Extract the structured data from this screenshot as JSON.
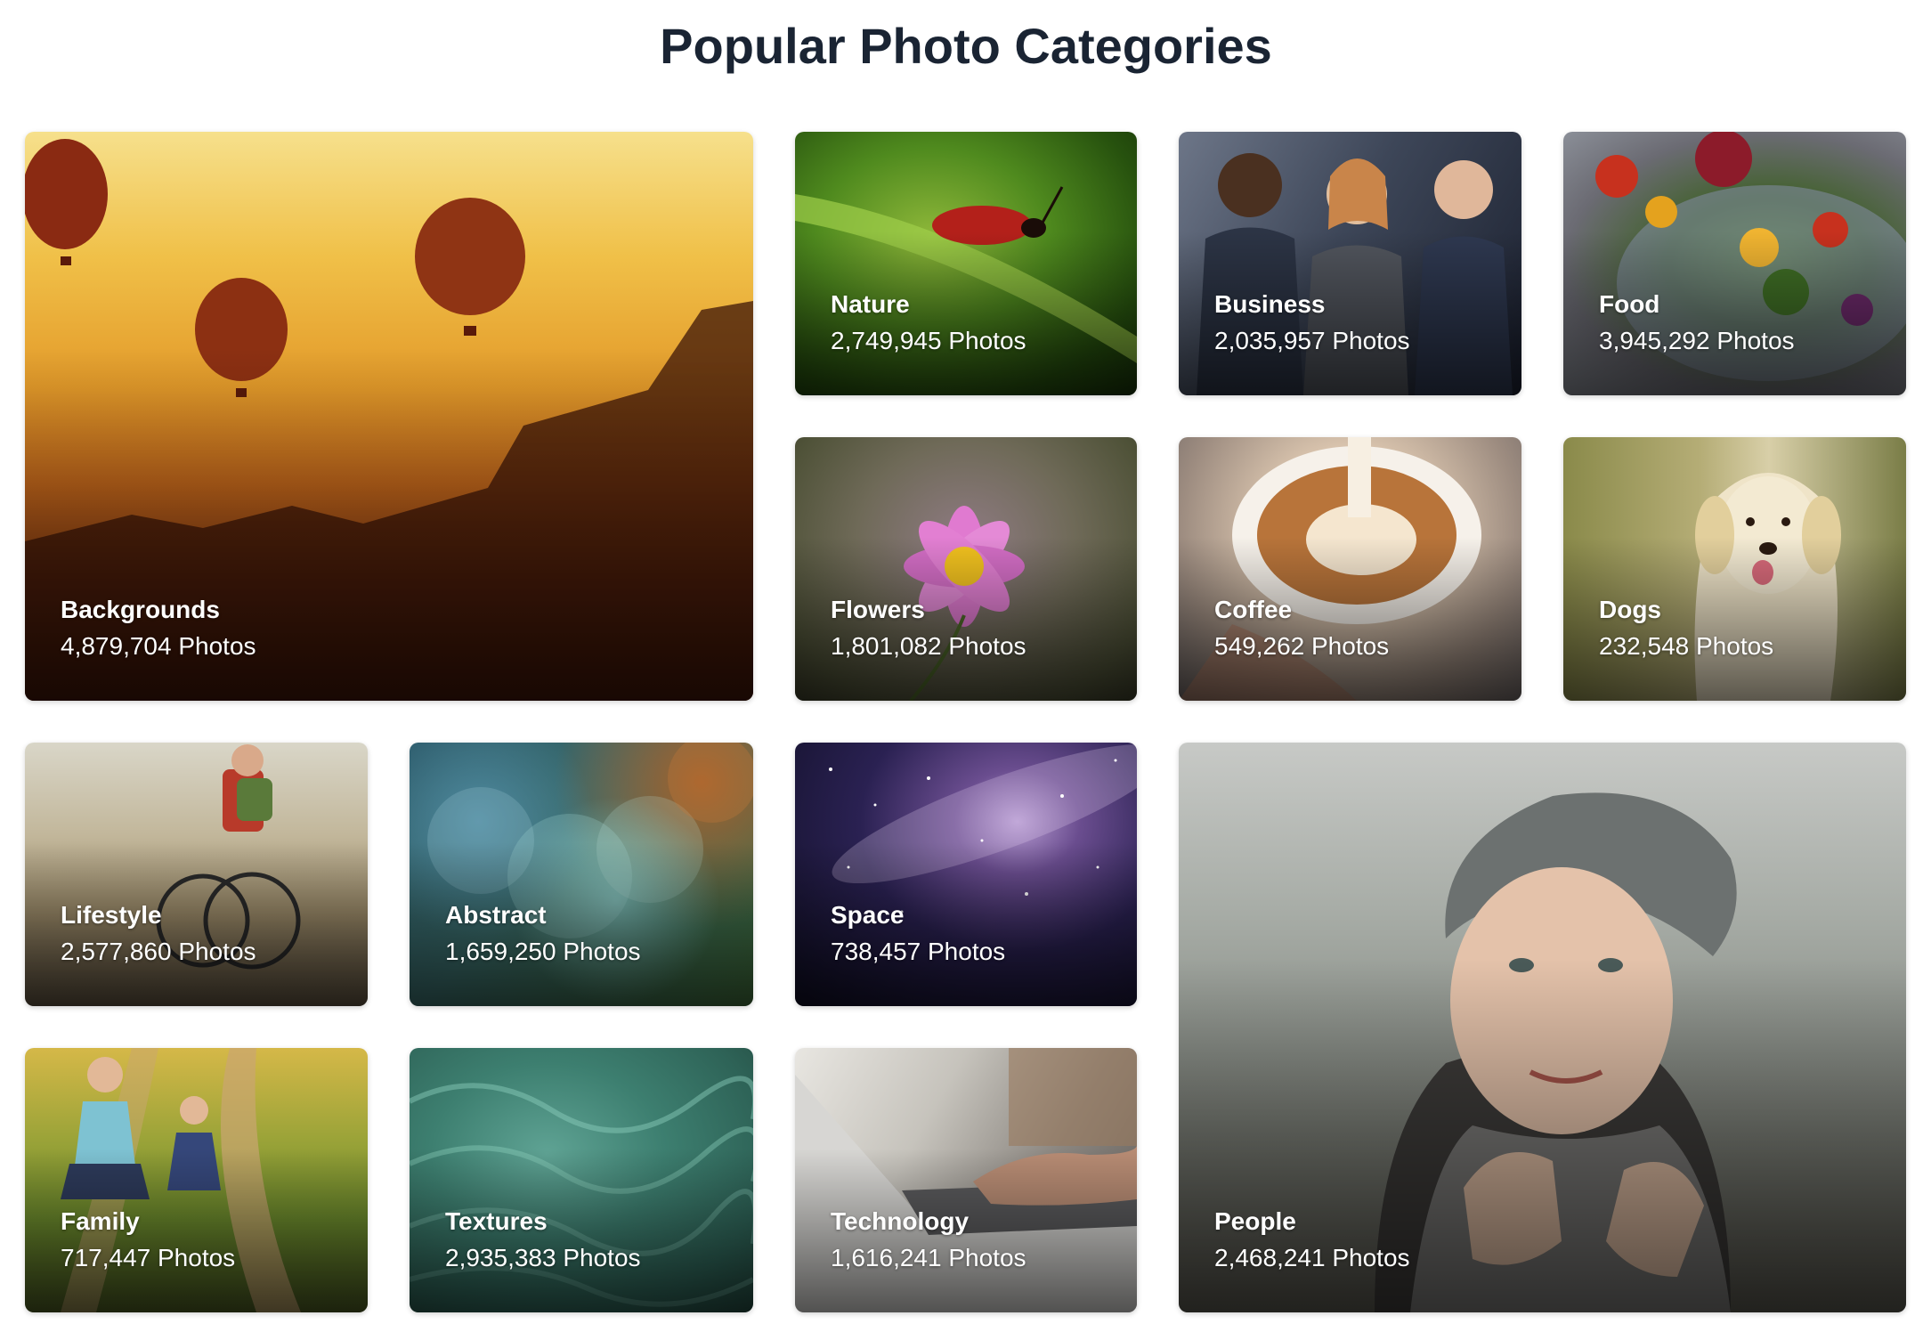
{
  "title": "Popular Photo Categories",
  "categories": [
    {
      "id": "backgrounds",
      "name": "Backgrounds",
      "count": "4,879,704 Photos"
    },
    {
      "id": "nature",
      "name": "Nature",
      "count": "2,749,945 Photos"
    },
    {
      "id": "business",
      "name": "Business",
      "count": "2,035,957 Photos"
    },
    {
      "id": "food",
      "name": "Food",
      "count": "3,945,292 Photos"
    },
    {
      "id": "flowers",
      "name": "Flowers",
      "count": "1,801,082 Photos"
    },
    {
      "id": "coffee",
      "name": "Coffee",
      "count": "549,262 Photos"
    },
    {
      "id": "dogs",
      "name": "Dogs",
      "count": "232,548 Photos"
    },
    {
      "id": "lifestyle",
      "name": "Lifestyle",
      "count": "2,577,860 Photos"
    },
    {
      "id": "abstract",
      "name": "Abstract",
      "count": "1,659,250 Photos"
    },
    {
      "id": "space",
      "name": "Space",
      "count": "738,457 Photos"
    },
    {
      "id": "people",
      "name": "People",
      "count": "2,468,241 Photos"
    },
    {
      "id": "family",
      "name": "Family",
      "count": "717,447 Photos"
    },
    {
      "id": "textures",
      "name": "Textures",
      "count": "2,935,383 Photos"
    },
    {
      "id": "technology",
      "name": "Technology",
      "count": "1,616,241 Photos"
    }
  ]
}
